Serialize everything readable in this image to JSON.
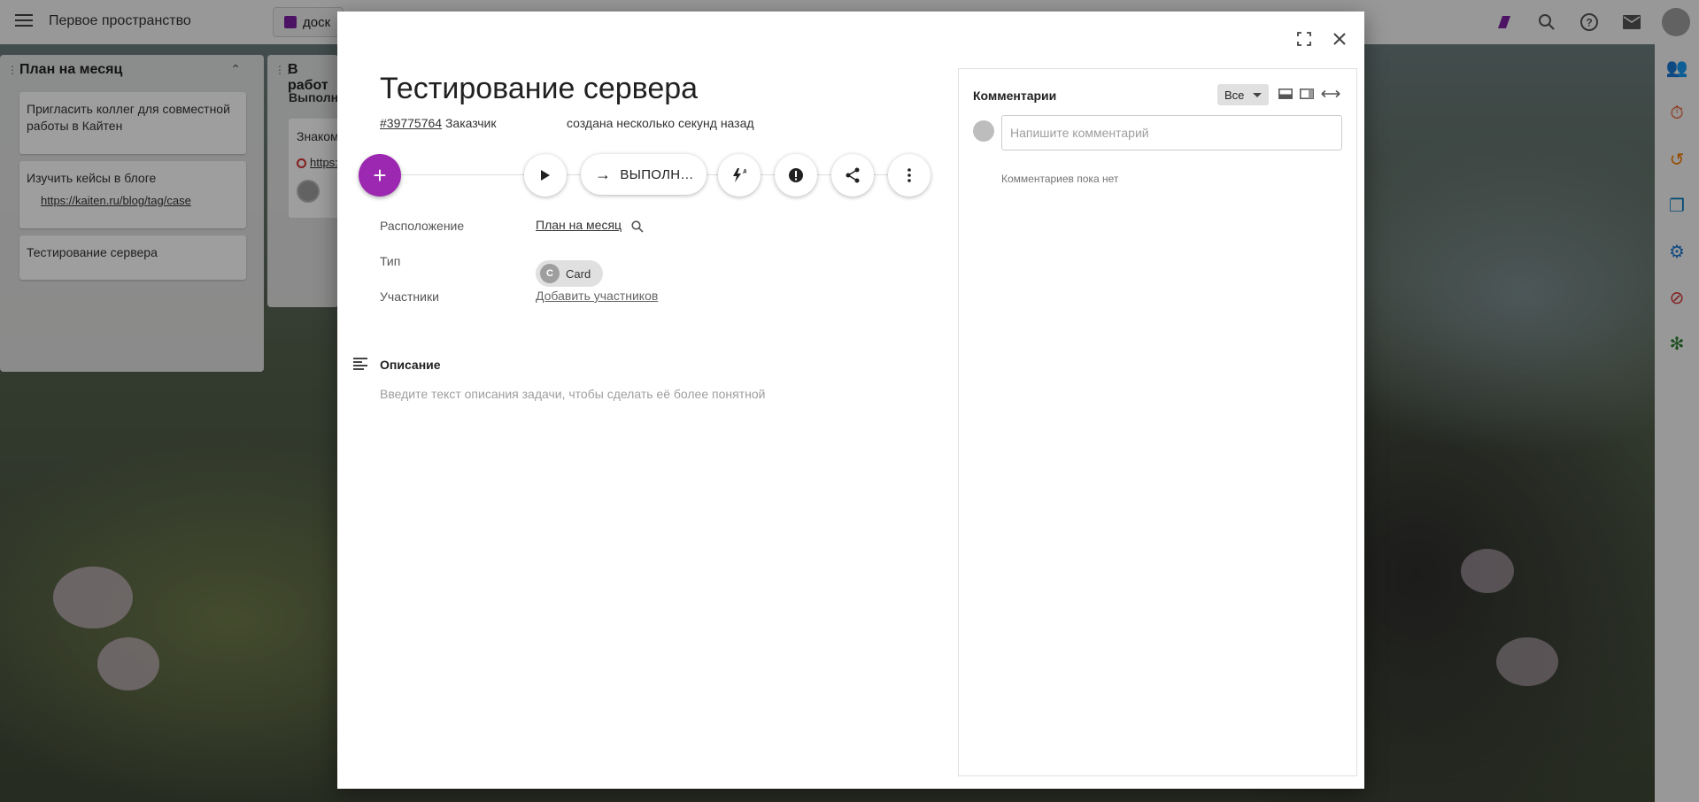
{
  "workspace": {
    "title": "Первое пространство",
    "board_tab": "доск"
  },
  "board": {
    "columns": [
      {
        "title": "План на месяц",
        "cards": [
          {
            "title": "Пригласить коллег для совместной работы в Кайтен"
          },
          {
            "title": "Изучить кейсы в блоге",
            "link": "https://kaiten.ru/blog/tag/case"
          },
          {
            "title": "Тестирование сервера"
          }
        ]
      },
      {
        "title": "В работ",
        "subtitle": "Выполн",
        "cards": [
          {
            "title": "Знаком",
            "link": "https:"
          }
        ]
      }
    ]
  },
  "card_modal": {
    "title": "Тестирование сервера",
    "card_id": "#39775764",
    "customer_label": "Заказчик",
    "created": "создана несколько секунд назад",
    "actions": {
      "add": "+",
      "status_button": "ВЫПОЛН…"
    },
    "properties": {
      "location_label": "Расположение",
      "location_value": "План на месяц",
      "type_label": "Тип",
      "type_initial": "C",
      "type_value": "Card",
      "members_label": "Участники",
      "members_value": "Добавить участников"
    },
    "description": {
      "title": "Описание",
      "placeholder": "Введите текст описания задачи, чтобы сделать её более понятной"
    },
    "comments": {
      "title": "Комментарии",
      "filter": "Все",
      "input_placeholder": "Напишите комментарий",
      "empty": "Комментариев пока нет"
    }
  },
  "colors": {
    "accent": "#9c27b0",
    "error": "#d32f2f"
  },
  "icons": [
    "menu-icon",
    "search-icon",
    "help-icon",
    "mail-icon",
    "expand-icon",
    "close-icon",
    "play-icon",
    "arrow-right-icon",
    "flash-icon",
    "priority-icon",
    "share-icon",
    "more-vert-icon",
    "description-icon"
  ]
}
